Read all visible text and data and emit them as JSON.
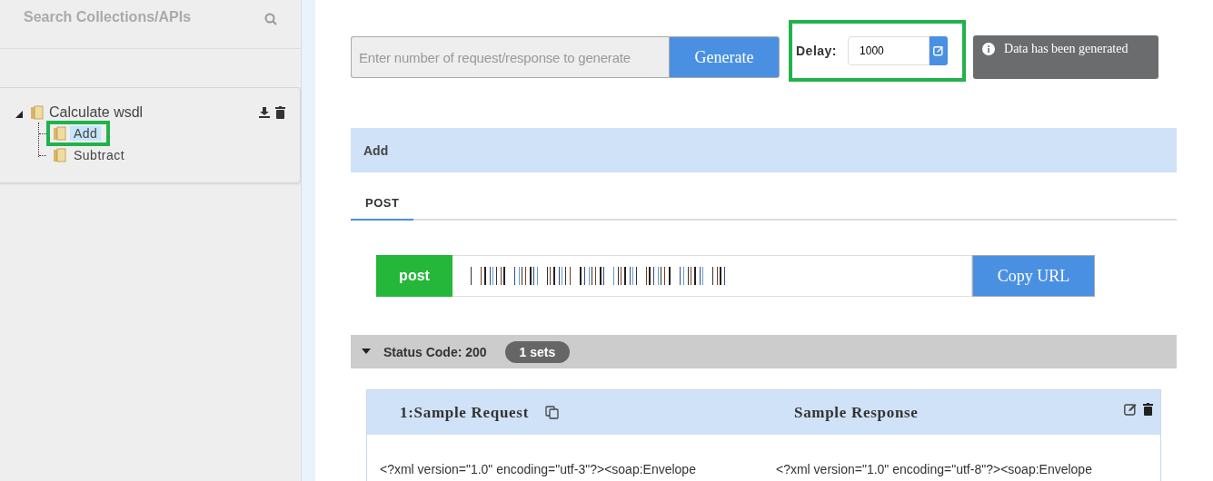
{
  "sidebar": {
    "search": {
      "placeholder": "Search Collections/APIs"
    },
    "tree": [
      {
        "label": "Calculate wsdl",
        "expanded": true,
        "selected": false,
        "children": [
          {
            "label": "Add",
            "selected": true,
            "highlighted": true
          },
          {
            "label": "Subtract",
            "selected": false,
            "highlighted": false
          }
        ]
      }
    ]
  },
  "generator": {
    "count_field": {
      "placeholder": "Enter number of request/response to generate"
    },
    "button": "Generate"
  },
  "delay": {
    "label": "Delay:",
    "value": "1000",
    "highlighted": true
  },
  "toast": {
    "message": "Data has been generated"
  },
  "operation": {
    "title": "Add"
  },
  "tabs": [
    {
      "label": "POST",
      "selected": true
    }
  ],
  "endpoint": {
    "method": "post",
    "button": "Copy URL"
  },
  "status": {
    "label": "Status Code: 200",
    "count": "1 sets",
    "expanded": true
  },
  "sample": {
    "request_title": "1:Sample Request",
    "response_title": "Sample Response",
    "request_body": "<?xml version=\"1.0\" encoding=\"utf-3\"?><soap:Envelope",
    "response_body": "<?xml version=\"1.0\" encoding=\"utf-8\"?><soap:Envelope"
  }
}
